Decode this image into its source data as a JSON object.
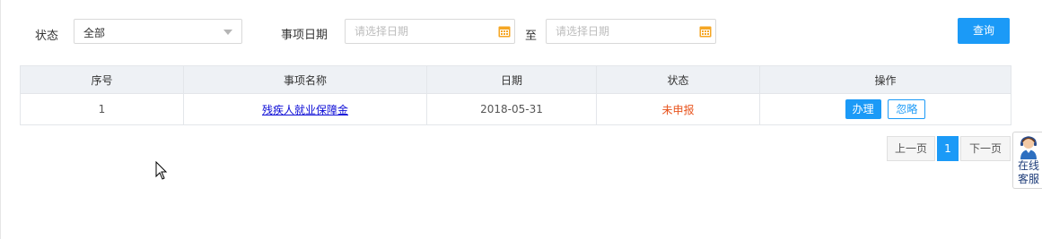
{
  "filters": {
    "status_label": "状态",
    "status_value": "全部",
    "date_label": "事项日期",
    "date_start_placeholder": "请选择日期",
    "date_to": "至",
    "date_end_placeholder": "请选择日期",
    "query_label": "查询"
  },
  "table": {
    "headers": [
      "序号",
      "事项名称",
      "日期",
      "状态",
      "操作"
    ],
    "rows": [
      {
        "index": "1",
        "name": "残疾人就业保障金",
        "date": "2018-05-31",
        "status": "未申报",
        "action_handle": "办理",
        "action_ignore": "忽略"
      }
    ]
  },
  "pagination": {
    "prev": "上一页",
    "current": "1",
    "next": "下一页"
  },
  "customer_service": {
    "line1": "在线",
    "line2": "客服"
  },
  "colors": {
    "accent": "#1b9af7",
    "status_pending": "#e8541e",
    "link": "#0b0bd6",
    "header_bg": "#eef1f5"
  }
}
